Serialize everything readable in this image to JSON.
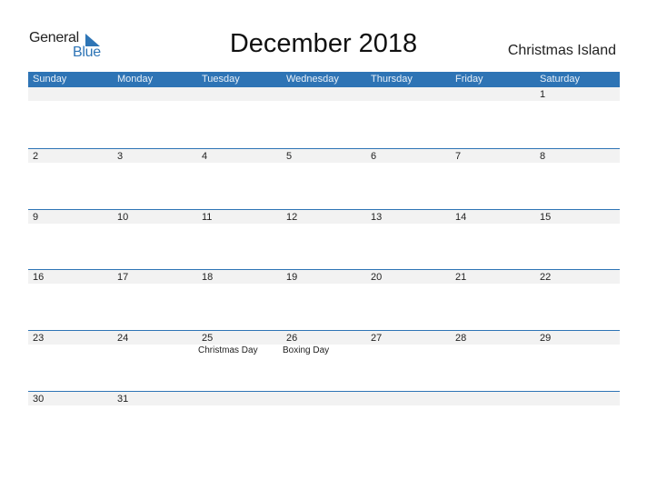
{
  "logo": {
    "word1": "General",
    "word2": "Blue",
    "icon": "triangle-flag-icon"
  },
  "title": "December 2018",
  "country": "Christmas Island",
  "colors": {
    "accent": "#2e74b5",
    "band": "#f2f2f2"
  },
  "days_of_week": [
    "Sunday",
    "Monday",
    "Tuesday",
    "Wednesday",
    "Thursday",
    "Friday",
    "Saturday"
  ],
  "weeks": [
    {
      "days": [
        {
          "num": "",
          "holiday": ""
        },
        {
          "num": "",
          "holiday": ""
        },
        {
          "num": "",
          "holiday": ""
        },
        {
          "num": "",
          "holiday": ""
        },
        {
          "num": "",
          "holiday": ""
        },
        {
          "num": "",
          "holiday": ""
        },
        {
          "num": "1",
          "holiday": ""
        }
      ]
    },
    {
      "days": [
        {
          "num": "2",
          "holiday": ""
        },
        {
          "num": "3",
          "holiday": ""
        },
        {
          "num": "4",
          "holiday": ""
        },
        {
          "num": "5",
          "holiday": ""
        },
        {
          "num": "6",
          "holiday": ""
        },
        {
          "num": "7",
          "holiday": ""
        },
        {
          "num": "8",
          "holiday": ""
        }
      ]
    },
    {
      "days": [
        {
          "num": "9",
          "holiday": ""
        },
        {
          "num": "10",
          "holiday": ""
        },
        {
          "num": "11",
          "holiday": ""
        },
        {
          "num": "12",
          "holiday": ""
        },
        {
          "num": "13",
          "holiday": ""
        },
        {
          "num": "14",
          "holiday": ""
        },
        {
          "num": "15",
          "holiday": ""
        }
      ]
    },
    {
      "days": [
        {
          "num": "16",
          "holiday": ""
        },
        {
          "num": "17",
          "holiday": ""
        },
        {
          "num": "18",
          "holiday": ""
        },
        {
          "num": "19",
          "holiday": ""
        },
        {
          "num": "20",
          "holiday": ""
        },
        {
          "num": "21",
          "holiday": ""
        },
        {
          "num": "22",
          "holiday": ""
        }
      ]
    },
    {
      "days": [
        {
          "num": "23",
          "holiday": ""
        },
        {
          "num": "24",
          "holiday": ""
        },
        {
          "num": "25",
          "holiday": "Christmas Day"
        },
        {
          "num": "26",
          "holiday": "Boxing Day"
        },
        {
          "num": "27",
          "holiday": ""
        },
        {
          "num": "28",
          "holiday": ""
        },
        {
          "num": "29",
          "holiday": ""
        }
      ]
    },
    {
      "days": [
        {
          "num": "30",
          "holiday": ""
        },
        {
          "num": "31",
          "holiday": ""
        },
        {
          "num": "",
          "holiday": ""
        },
        {
          "num": "",
          "holiday": ""
        },
        {
          "num": "",
          "holiday": ""
        },
        {
          "num": "",
          "holiday": ""
        },
        {
          "num": "",
          "holiday": ""
        }
      ]
    }
  ]
}
